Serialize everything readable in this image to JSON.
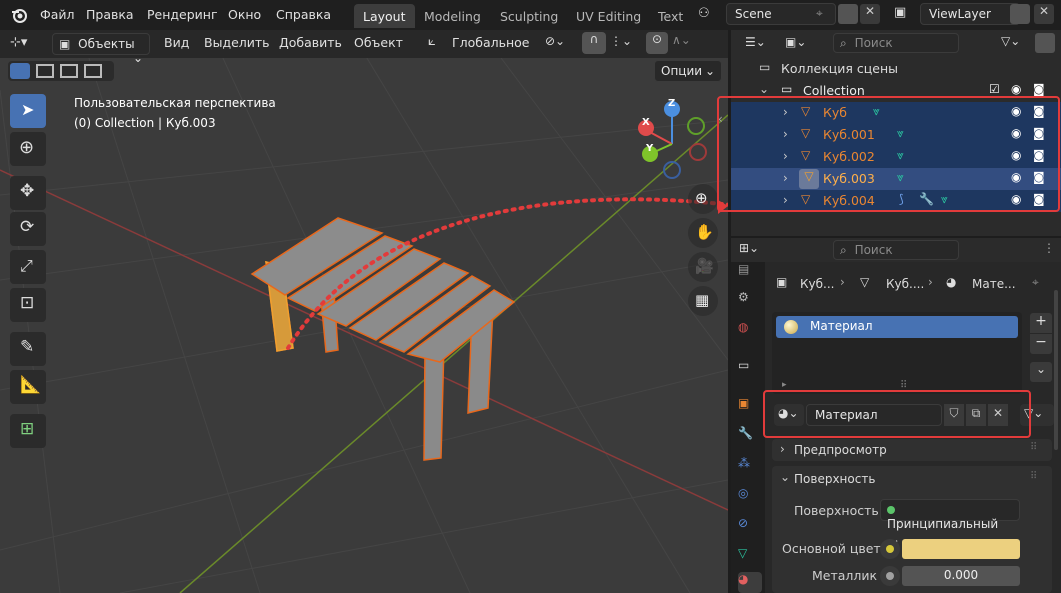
{
  "topbar": {
    "menus": [
      "Файл",
      "Правка",
      "Рендеринг",
      "Окно",
      "Справка"
    ],
    "workspace_tabs": [
      "Layout",
      "Modeling",
      "Sculpting",
      "UV Editing",
      "Text"
    ],
    "scene": "Scene",
    "view_layer": "ViewLayer"
  },
  "viewport": {
    "mode": "Объекты",
    "menus": [
      "Вид",
      "Выделить",
      "Добавить",
      "Объект"
    ],
    "orientation": "Глобальное",
    "options": "Опции",
    "view_name": "Пользовательская перспектива",
    "context": "(0) Collection | Куб.003",
    "gizmo": {
      "x": "X",
      "y": "Y",
      "z": "Z"
    }
  },
  "outliner": {
    "search_placeholder": "Поиск",
    "scene_collection": "Коллекция сцены",
    "collection": "Collection",
    "objects": [
      "Куб",
      "Куб.001",
      "Куб.002",
      "Куб.003",
      "Куб.004"
    ]
  },
  "properties": {
    "search_placeholder": "Поиск",
    "breadcrumb": [
      "Куб...",
      "Куб....",
      "Мате..."
    ],
    "material_slot": "Материал",
    "material_name": "Материал",
    "panel_preview": "Предпросмотр",
    "panel_surface": "Поверхность",
    "surface_label": "Поверхность",
    "surface_value": "Принципиальный ...",
    "base_color_label": "Основной цвет",
    "base_color": "#ecd07f",
    "metallic_label": "Металлик",
    "metallic_value": "0.000"
  }
}
